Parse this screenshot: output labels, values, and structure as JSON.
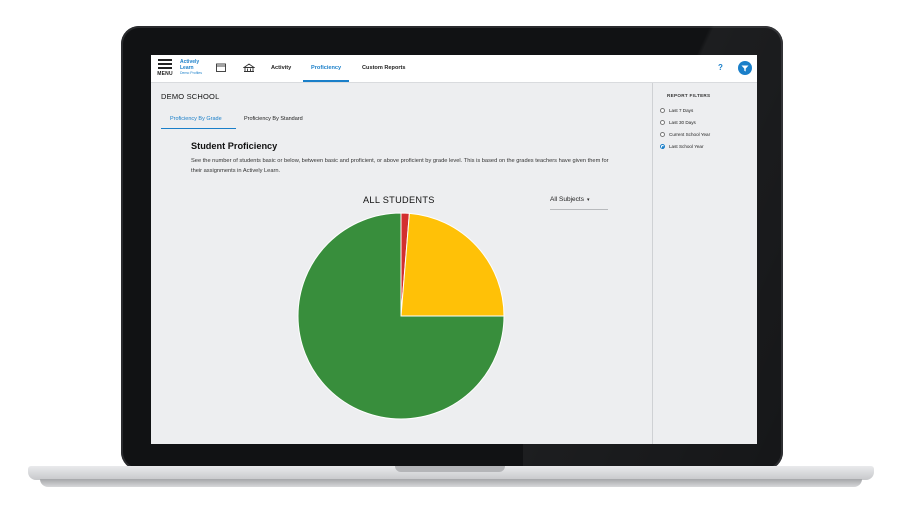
{
  "header": {
    "menu_label": "MENU",
    "logo_line1": "Actively",
    "logo_line2": "Learn",
    "logo_sub": "Demo Profiles",
    "nav": [
      {
        "label": "Activity",
        "active": false
      },
      {
        "label": "Proficiency",
        "active": true
      },
      {
        "label": "Custom Reports",
        "active": false
      }
    ],
    "help_label": "?"
  },
  "main": {
    "school_name": "DEMO SCHOOL",
    "tabs": [
      {
        "label": "Proficiency By Grade",
        "active": true
      },
      {
        "label": "Proficiency By Standard",
        "active": false
      }
    ],
    "section_title": "Student Proficiency",
    "description": "See the number of students basic or below, between basic and proficient, or above proficient by grade level. This is based on the grades teachers have given them for their assignments in Actively Learn.",
    "subject_select": "All Subjects"
  },
  "report_filters": {
    "title": "REPORT FILTERS",
    "options": [
      {
        "label": "Last 7 Days",
        "selected": false
      },
      {
        "label": "Last 30 Days",
        "selected": false
      },
      {
        "label": "Current School Year",
        "selected": false
      },
      {
        "label": "Last School Year",
        "selected": true
      }
    ]
  },
  "colors": {
    "accent": "#1a7fc9",
    "slice_red": "#d32f2f",
    "slice_yellow": "#ffc107",
    "slice_green": "#388e3c"
  },
  "chart_data": {
    "type": "pie",
    "title": "ALL STUDENTS",
    "values": [
      1.3,
      23.7,
      75.0
    ],
    "colors": [
      "#d32f2f",
      "#ffc107",
      "#388e3c"
    ]
  }
}
